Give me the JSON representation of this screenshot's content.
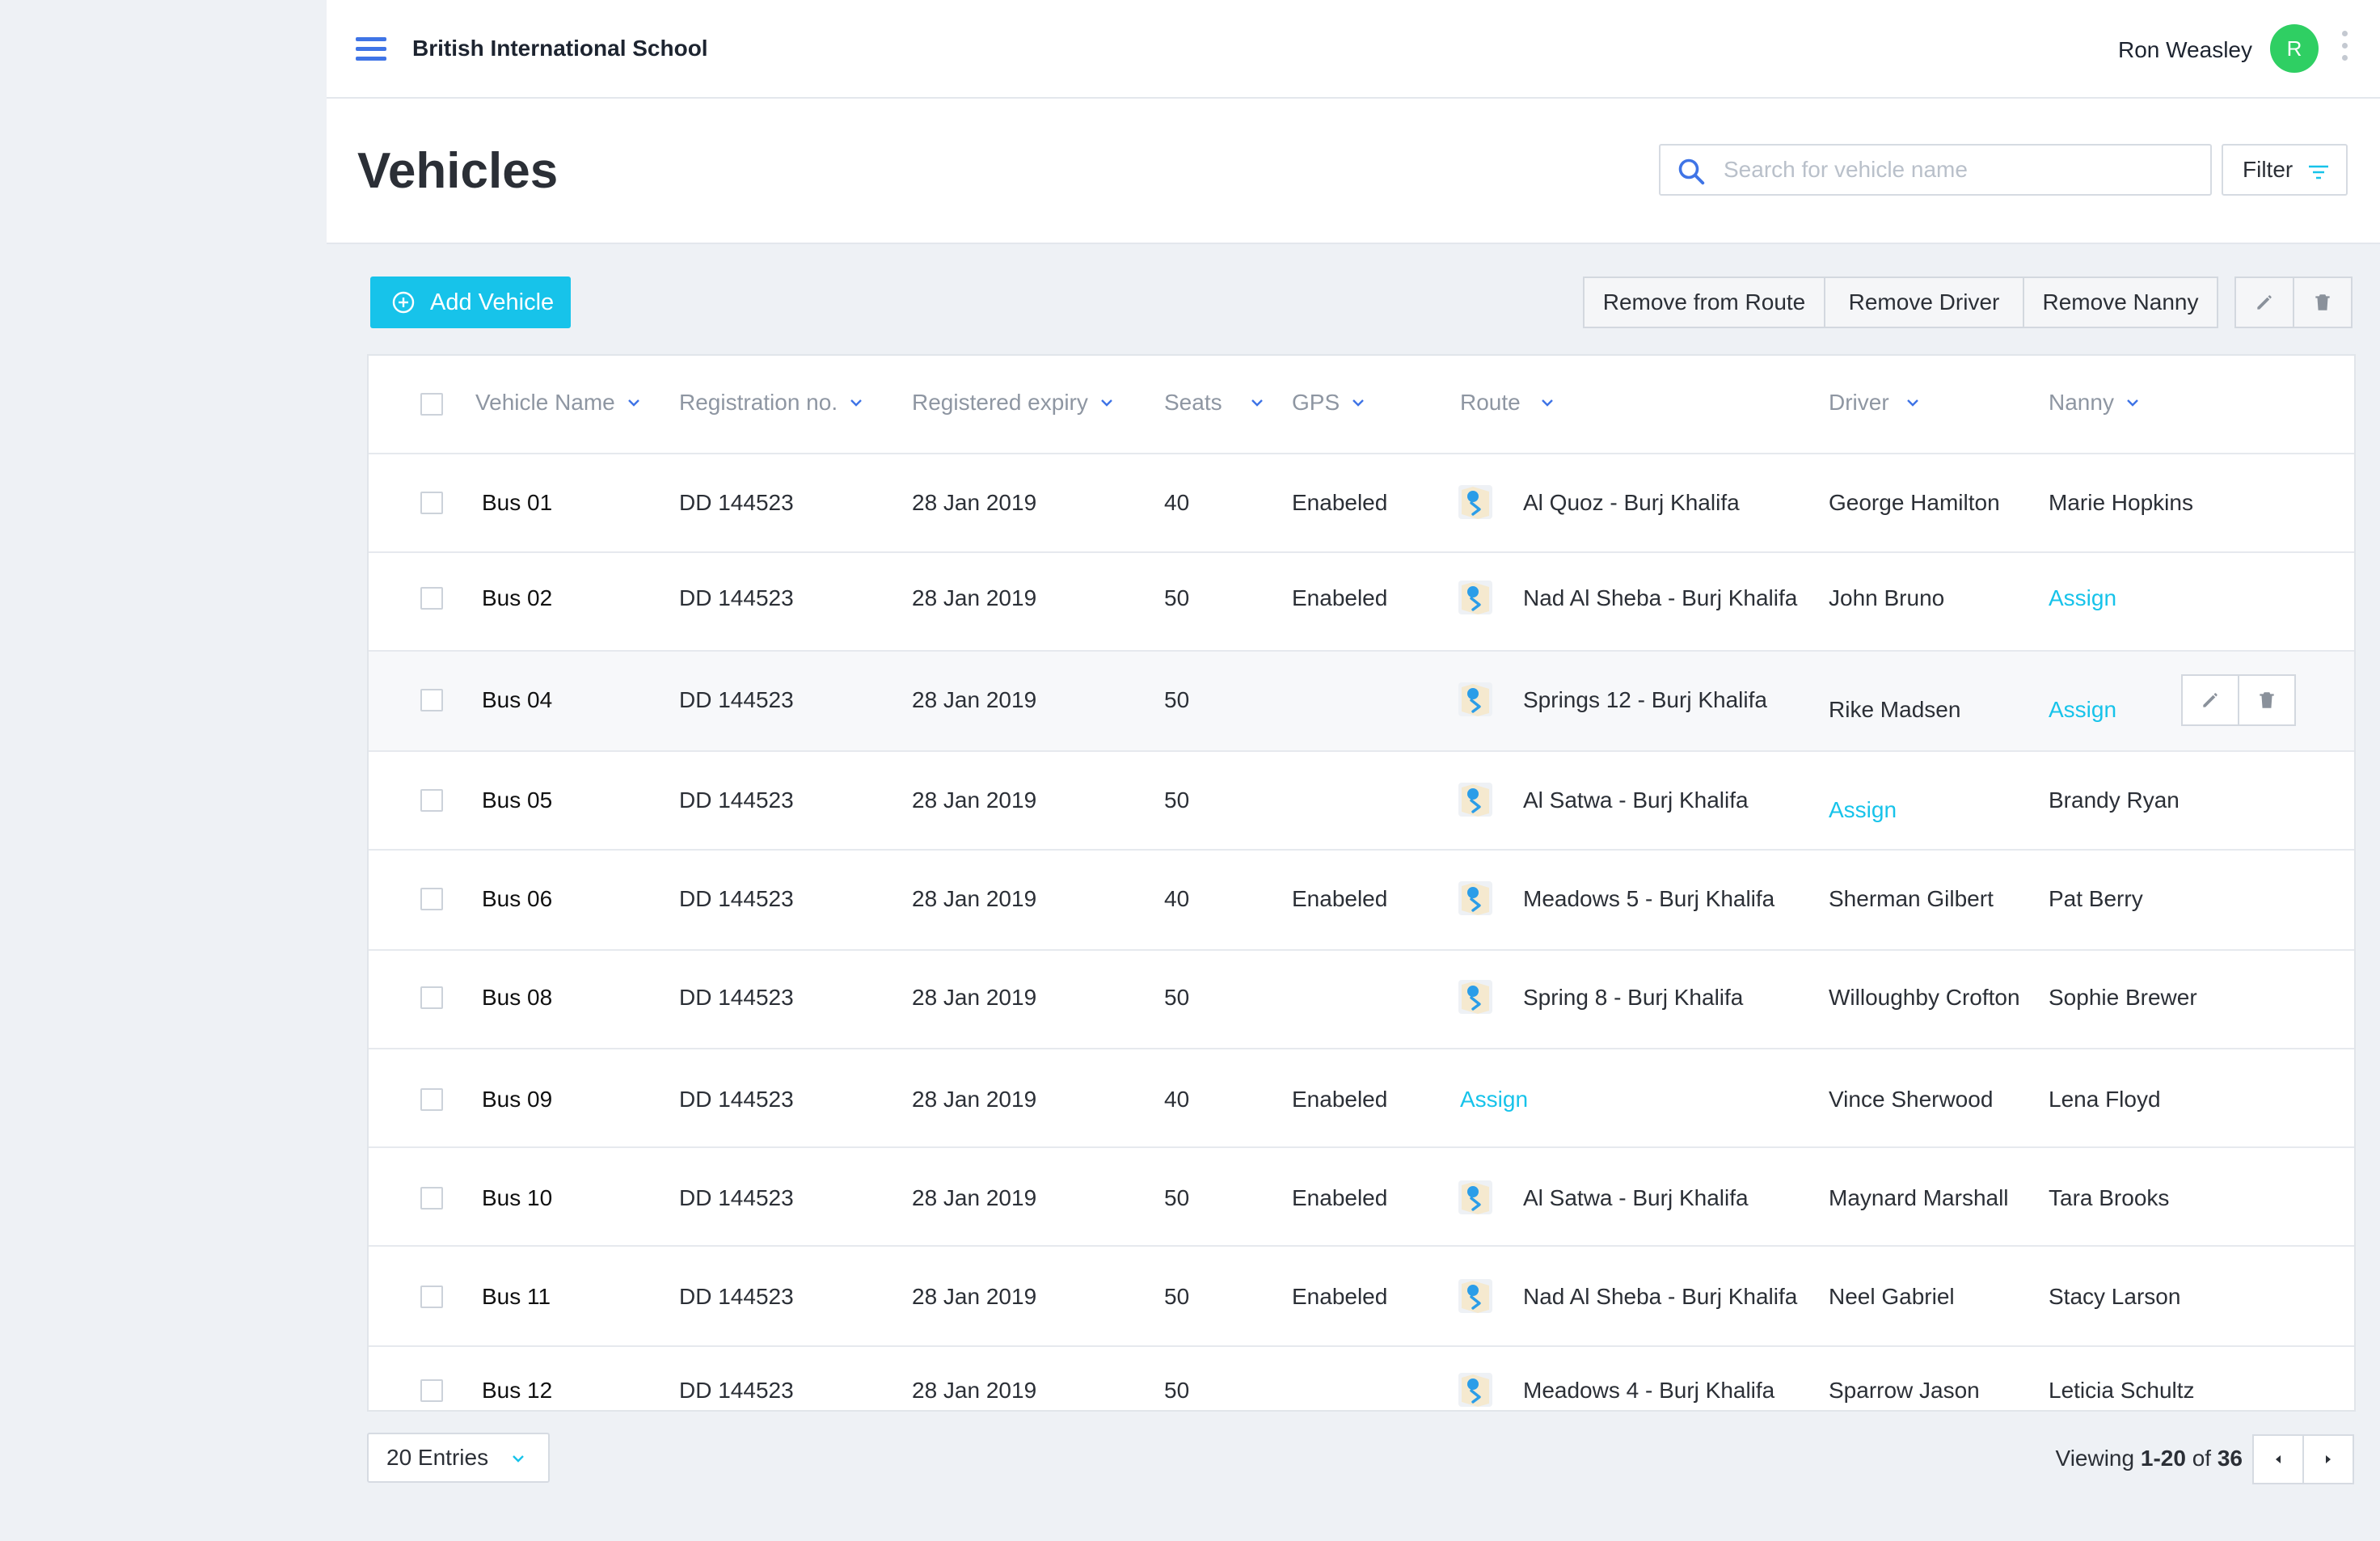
{
  "app": {
    "school_name": "British International School",
    "user_name": "Ron Weasley",
    "avatar_initial": "R"
  },
  "page": {
    "title": "Vehicles",
    "search_placeholder": "Search for vehicle name",
    "filter_label": "Filter"
  },
  "toolbar": {
    "add_label": "Add Vehicle",
    "remove_route": "Remove from Route",
    "remove_driver": "Remove Driver",
    "remove_nanny": "Remove Nanny"
  },
  "columns": {
    "vehicle_name": "Vehicle Name",
    "registration": "Registration no.",
    "expiry": "Registered expiry",
    "seats": "Seats",
    "gps": "GPS",
    "route": "Route",
    "driver": "Driver",
    "nanny": "Nanny"
  },
  "rows": [
    {
      "name": "Bus 01",
      "reg": "DD 144523",
      "expiry": "28 Jan 2019",
      "seats": "40",
      "gps": "Enabeled",
      "route": "Al Quoz - Burj Khalifa",
      "driver": "George Hamilton",
      "nanny": "Marie Hopkins"
    },
    {
      "name": "Bus 02",
      "reg": "DD 144523",
      "expiry": "28 Jan 2019",
      "seats": "50",
      "gps": "Enabeled",
      "route": "Nad Al Sheba - Burj Khalifa",
      "driver": "John Bruno",
      "nanny": "Assign"
    },
    {
      "name": "Bus 04",
      "reg": "DD 144523",
      "expiry": "28 Jan 2019",
      "seats": "50",
      "gps": "",
      "route": "Springs 12 - Burj Khalifa",
      "driver": "Rike Madsen",
      "nanny": "Assign"
    },
    {
      "name": "Bus 05",
      "reg": "DD 144523",
      "expiry": "28 Jan 2019",
      "seats": "50",
      "gps": "",
      "route": "Al Satwa - Burj Khalifa",
      "driver": "Assign",
      "nanny": "Brandy Ryan"
    },
    {
      "name": "Bus 06",
      "reg": "DD 144523",
      "expiry": "28 Jan 2019",
      "seats": "40",
      "gps": "Enabeled",
      "route": "Meadows 5 - Burj Khalifa",
      "driver": "Sherman Gilbert",
      "nanny": "Pat Berry"
    },
    {
      "name": "Bus 08",
      "reg": "DD 144523",
      "expiry": "28 Jan 2019",
      "seats": "50",
      "gps": "",
      "route": "Spring 8 - Burj Khalifa",
      "driver": "Willoughby Crofton",
      "nanny": "Sophie Brewer"
    },
    {
      "name": "Bus 09",
      "reg": "DD 144523",
      "expiry": "28 Jan 2019",
      "seats": "40",
      "gps": "Enabeled",
      "route": "Assign",
      "driver": "Vince Sherwood",
      "nanny": "Lena Floyd"
    },
    {
      "name": "Bus 10",
      "reg": "DD 144523",
      "expiry": "28 Jan 2019",
      "seats": "50",
      "gps": "Enabeled",
      "route": "Al Satwa - Burj Khalifa",
      "driver": "Maynard Marshall",
      "nanny": "Tara Brooks"
    },
    {
      "name": "Bus 11",
      "reg": "DD 144523",
      "expiry": "28 Jan 2019",
      "seats": "50",
      "gps": "Enabeled",
      "route": "Nad Al Sheba - Burj Khalifa",
      "driver": "Neel Gabriel",
      "nanny": "Stacy Larson"
    },
    {
      "name": "Bus 12",
      "reg": "DD 144523",
      "expiry": "28 Jan 2019",
      "seats": "50",
      "gps": "",
      "route": "Meadows 4 - Burj Khalifa",
      "driver": "Sparrow Jason",
      "nanny": "Leticia Schultz"
    }
  ],
  "footer": {
    "entries_label": "20 Entries",
    "viewing_prefix": "Viewing",
    "viewing_range": "1-20",
    "viewing_of": "of",
    "viewing_total": "36"
  },
  "colors": {
    "accent": "#17c3ea",
    "hamburger": "#3f74e6",
    "avatar": "#2fcf63"
  },
  "icons": {
    "menu": "hamburger-icon",
    "search": "search-icon",
    "filter": "filter-icon",
    "add": "plus-circle-icon",
    "edit": "pencil-icon",
    "delete": "trash-icon",
    "route": "map-pin-icon",
    "sort": "chevron-down-icon"
  }
}
